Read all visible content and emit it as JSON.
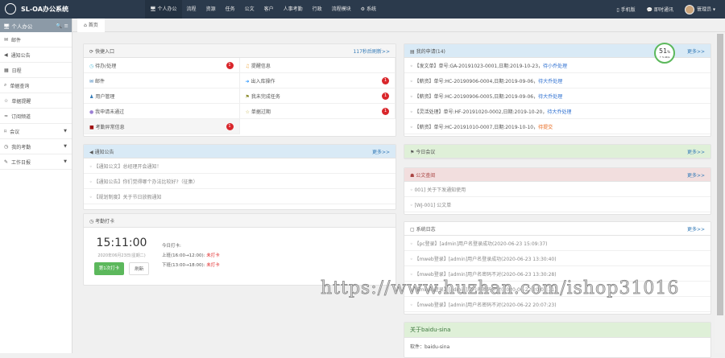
{
  "app": {
    "title": "SL-OA办公系统"
  },
  "nav": [
    "个人办公",
    "流程",
    "资源",
    "任务",
    "公文",
    "客户",
    "人事考勤",
    "行政",
    "流程模块",
    "系统"
  ],
  "topright": {
    "mobile": "手机版",
    "im": "即时通讯",
    "user": "管理员"
  },
  "sidebar": {
    "title": "个人办公",
    "items": [
      {
        "label": "邮件"
      },
      {
        "label": "通知公告"
      },
      {
        "label": "日程"
      },
      {
        "label": "单据查询"
      },
      {
        "label": "单据提醒"
      },
      {
        "label": "订阅频道"
      },
      {
        "label": "会议"
      },
      {
        "label": "我的考勤"
      },
      {
        "label": "工作日报"
      }
    ]
  },
  "tab": "首页",
  "quick": {
    "title": "快捷入口",
    "refresh": "117秒后刷新>>",
    "items": [
      {
        "label": "待办/处理",
        "badge": "1"
      },
      {
        "label": "提醒信息",
        "badge": ""
      },
      {
        "label": "邮件",
        "badge": ""
      },
      {
        "label": "出入库操作",
        "badge": "1"
      },
      {
        "label": "用户管理",
        "badge": ""
      },
      {
        "label": "我未完成任务",
        "badge": "1"
      },
      {
        "label": "我申请未通过",
        "badge": ""
      },
      {
        "label": "单据过期",
        "badge": "1"
      },
      {
        "label": "考勤异常信息",
        "badge": "1"
      }
    ]
  },
  "apply": {
    "title": "我的申请(14)",
    "more": "更多>>",
    "progress": "51",
    "progress_unit": "%",
    "progress_sub": "↑ 5.4K/s",
    "items": [
      {
        "text": "【发文单】单号:GA-20191023-0001,日期:2019-10-23，",
        "status": "待小乔处理",
        "color": "blue"
      },
      {
        "text": "【薪资】单号:HC-20190906-0004,日期:2019-09-06，",
        "status": "待大乔处理",
        "color": "blue"
      },
      {
        "text": "【薪资】单号:HC-20190906-0005,日期:2019-09-06，",
        "status": "待大乔处理",
        "color": "blue"
      },
      {
        "text": "【灵活处理】单号:HF-20191020-0002,日期:2019-10-20，",
        "status": "待大乔处理",
        "color": "blue"
      },
      {
        "text": "【薪资】单号:HC-20191010-0007,日期:2019-10-10，",
        "status": "待提交",
        "color": "orange"
      }
    ]
  },
  "notice": {
    "title": "通知公告",
    "more": "更多>>",
    "items": [
      "【通知公文】总经理开会通知！",
      "【通知公告】你们觉得哪个办法比较好?（征集）",
      "【规划制度】关于节日放假通知"
    ]
  },
  "attend": {
    "title": "考勤打卡",
    "time": "15:11:00",
    "date": "2020年06月23日(星期二)",
    "today": "今日打卡:",
    "am": "上班(16:00→12:00):",
    "pm": "下班(13:00→18:00):",
    "am_status": "未打卡",
    "pm_status": "未打卡",
    "punch": "第1次打卡",
    "refresh": "刷新"
  },
  "meeting": {
    "title": "今日会议",
    "more": "更多>>"
  },
  "docs": {
    "title": "公文查阅",
    "more": "更多>>",
    "items": [
      "001] 关于下发通知使用",
      "[WJ-001] 公文单"
    ]
  },
  "log": {
    "title": "系统日志",
    "more": "更多>>",
    "items": [
      "【pc登录】[admin]用户名登录成功(2020-06-23 15:09:37)",
      "【mweb登录】[admin]用户名登录成功(2020-06-23 13:30:40)",
      "【mweb登录】[admin]用户名密码不对(2020-06-23 13:30:28)",
      "【mweb登录】[admin]用户名密码不对(2020-06-22 20:07:31)",
      "【mweb登录】[admin]用户名密码不对(2020-06-22 20:07:23)"
    ]
  },
  "about": {
    "title": "关于baidu-sina",
    "software": "软件：baidu-sina"
  },
  "watermark": "https://www.huzhan.com/ishop31016"
}
